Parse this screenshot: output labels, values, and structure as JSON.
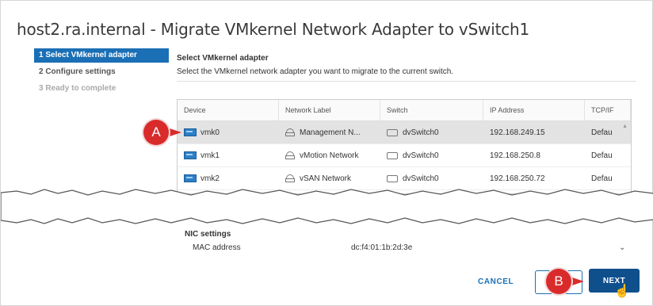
{
  "dialog": {
    "title": "host2.ra.internal - Migrate VMkernel Network Adapter to vSwitch1"
  },
  "steps": [
    {
      "label": "1 Select VMkernel adapter"
    },
    {
      "label": "2 Configure settings"
    },
    {
      "label": "3 Ready to complete"
    }
  ],
  "content": {
    "title": "Select VMkernel adapter",
    "description": "Select the VMkernel network adapter you want to migrate to the current switch."
  },
  "table": {
    "headers": [
      "Device",
      "Network Label",
      "Switch",
      "IP Address",
      "TCP/IF"
    ],
    "rows": [
      {
        "device": "vmk0",
        "network": "Management N...",
        "switch": "dvSwitch0",
        "ip": "192.168.249.15",
        "tcp": "Defau"
      },
      {
        "device": "vmk1",
        "network": "vMotion Network",
        "switch": "dvSwitch0",
        "ip": "192.168.250.8",
        "tcp": "Defau"
      },
      {
        "device": "vmk2",
        "network": "vSAN Network",
        "switch": "dvSwitch0",
        "ip": "192.168.250.72",
        "tcp": "Defau"
      }
    ],
    "selected_row": 0
  },
  "nic_settings": {
    "title": "NIC settings",
    "mac_label": "MAC address",
    "mac_value": "dc:f4:01:1b:2d:3e"
  },
  "footer": {
    "cancel_label": "CANCEL",
    "next_label": "NEXT"
  },
  "callouts": {
    "a": "A",
    "b": "B"
  },
  "colors": {
    "accent": "#1a6fb5",
    "primary_button": "#0e4f8c",
    "callout": "#d92b2b"
  }
}
